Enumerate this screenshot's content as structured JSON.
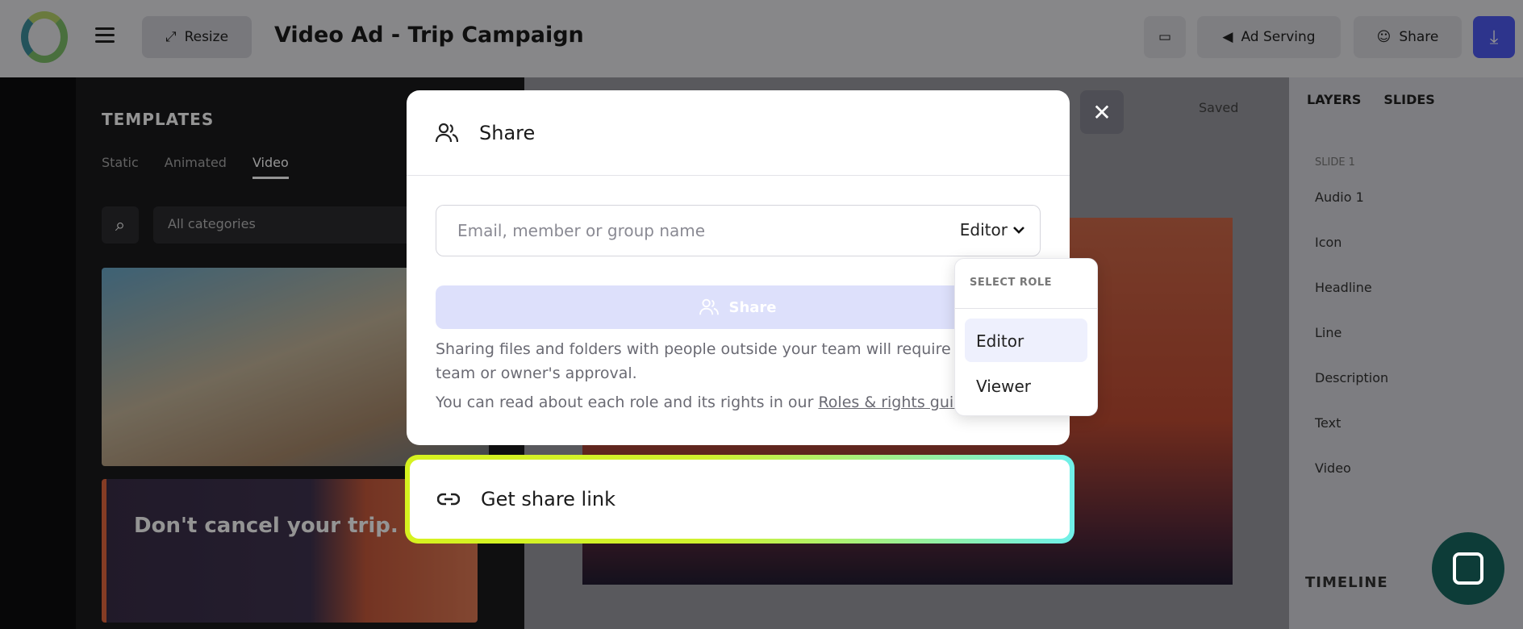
{
  "topbar": {
    "resize_label": "Resize",
    "title": "Video Ad - Trip Campaign",
    "ad_serving_label": "Ad Serving",
    "share_label": "Share"
  },
  "templates": {
    "title": "TEMPLATES",
    "tabs": [
      "Static",
      "Animated",
      "Video"
    ],
    "active_tab": "Video",
    "category_placeholder": "All categories",
    "thumb2_text": "Don't cancel your trip."
  },
  "canvas": {
    "saved_label": "Saved"
  },
  "right_panel": {
    "layers_tab": "LAYERS",
    "slides_tab": "SLIDES",
    "slide_label": "SLIDE 1",
    "layers": [
      "Audio 1",
      "Icon",
      "Headline",
      "Line",
      "Description",
      "Text",
      "Video"
    ],
    "timeline_label": "TIMELINE"
  },
  "share_modal": {
    "title": "Share",
    "email_placeholder": "Email, member or group name",
    "role_value": "Editor",
    "share_button": "Share",
    "note_line1": "Sharing files and folders with people outside your team will require the team or owner's approval.",
    "note_line2_prefix": "You can read about each role and its rights in our ",
    "note_link": "Roles & rights guide",
    "note_line2_suffix": "."
  },
  "role_dropdown": {
    "header": "SELECT ROLE",
    "options": [
      "Editor",
      "Viewer"
    ],
    "selected": "Editor"
  },
  "get_link": {
    "label": "Get share link"
  },
  "colors": {
    "accent": "#4f5bf2",
    "share_button_bg": "#dde0fb",
    "getlink_gradient_start": "#d6f21f",
    "getlink_gradient_end": "#6ff0ea",
    "chat_bubble": "#0d3c38"
  },
  "icons": [
    "menu-icon",
    "resize-icon",
    "comment-icon",
    "ad-serving-icon",
    "users-icon",
    "download-icon",
    "search-icon",
    "close-icon",
    "chevron-down-icon",
    "link-icon",
    "chat-icon"
  ]
}
